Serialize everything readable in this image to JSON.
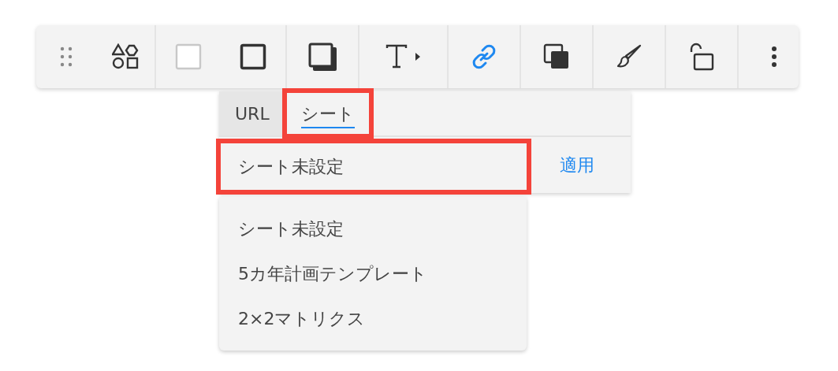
{
  "toolbar": {
    "groups": [
      [
        {
          "kind": "drag-handle",
          "selected": false
        },
        {
          "kind": "shapes",
          "selected": false
        }
      ],
      [
        {
          "kind": "fill",
          "selected": false
        },
        {
          "kind": "border",
          "selected": false
        }
      ],
      [
        {
          "kind": "shadow",
          "selected": false
        }
      ],
      [
        {
          "kind": "text",
          "selected": false
        }
      ],
      [
        {
          "kind": "link",
          "selected": true
        }
      ],
      [
        {
          "kind": "layer",
          "selected": false
        }
      ],
      [
        {
          "kind": "brush",
          "selected": false
        }
      ],
      [
        {
          "kind": "lock",
          "selected": false
        }
      ],
      [
        {
          "kind": "more",
          "selected": false
        }
      ]
    ]
  },
  "link_popup": {
    "tabs": [
      {
        "label": "URL",
        "selected": false,
        "highlighted": false
      },
      {
        "label": "シート",
        "selected": true,
        "highlighted": true
      }
    ],
    "field": {
      "value": "シート未設定",
      "highlighted": true,
      "expanded": true
    },
    "apply": "適用",
    "options": [
      {
        "label": "シート未設定"
      },
      {
        "label": "5カ年計画テンプレート"
      },
      {
        "label": "2×2マトリクス"
      }
    ]
  }
}
